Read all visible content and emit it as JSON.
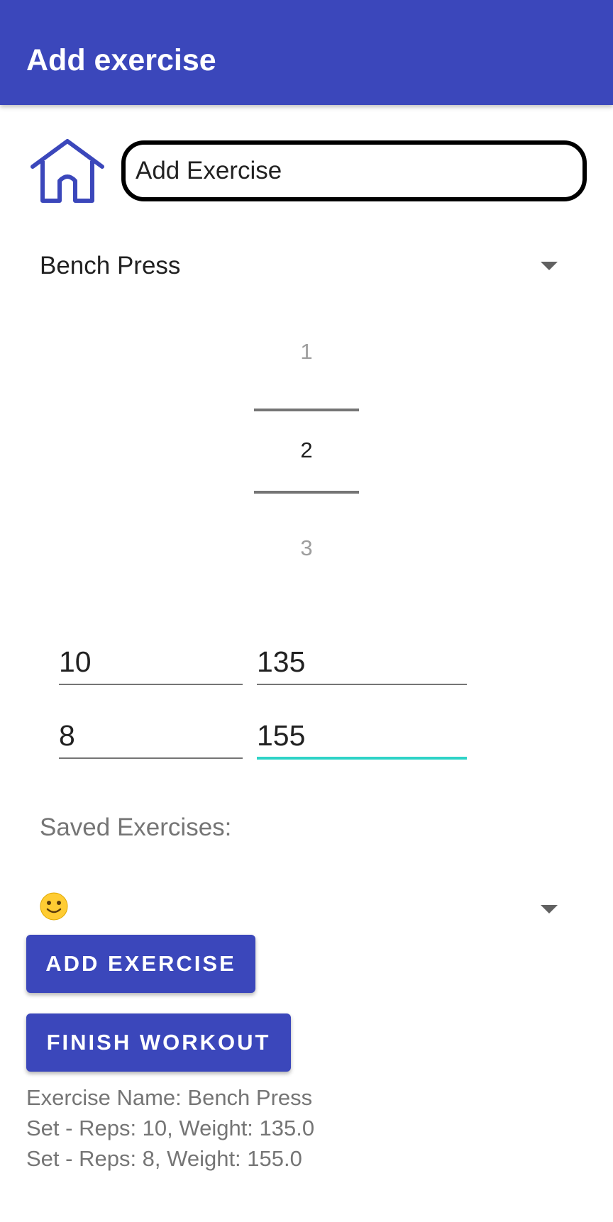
{
  "appbar": {
    "title": "Add exercise",
    "color": "#3b47bb"
  },
  "home": {
    "icon": "home-icon"
  },
  "exercise_input": {
    "value": "Add Exercise"
  },
  "exercise_spinner": {
    "selected": "Bench Press",
    "icon": "dropdown-caret-icon"
  },
  "set_picker": {
    "above": "1",
    "selected": "2",
    "below": "3"
  },
  "sets": [
    {
      "reps": "10",
      "weight": "135"
    },
    {
      "reps": "8",
      "weight": "155"
    }
  ],
  "saved": {
    "label": "Saved Exercises:",
    "selected_icon": "smiley-emoji-icon"
  },
  "buttons": {
    "add": "ADD EXERCISE",
    "finish": "FINISH WORKOUT"
  },
  "log": [
    "Exercise Name: Bench Press",
    "Set - Reps: 10, Weight: 135.0",
    "Set - Reps: 8, Weight: 155.0"
  ],
  "colors": {
    "accent_focus": "#2ed3c7"
  }
}
